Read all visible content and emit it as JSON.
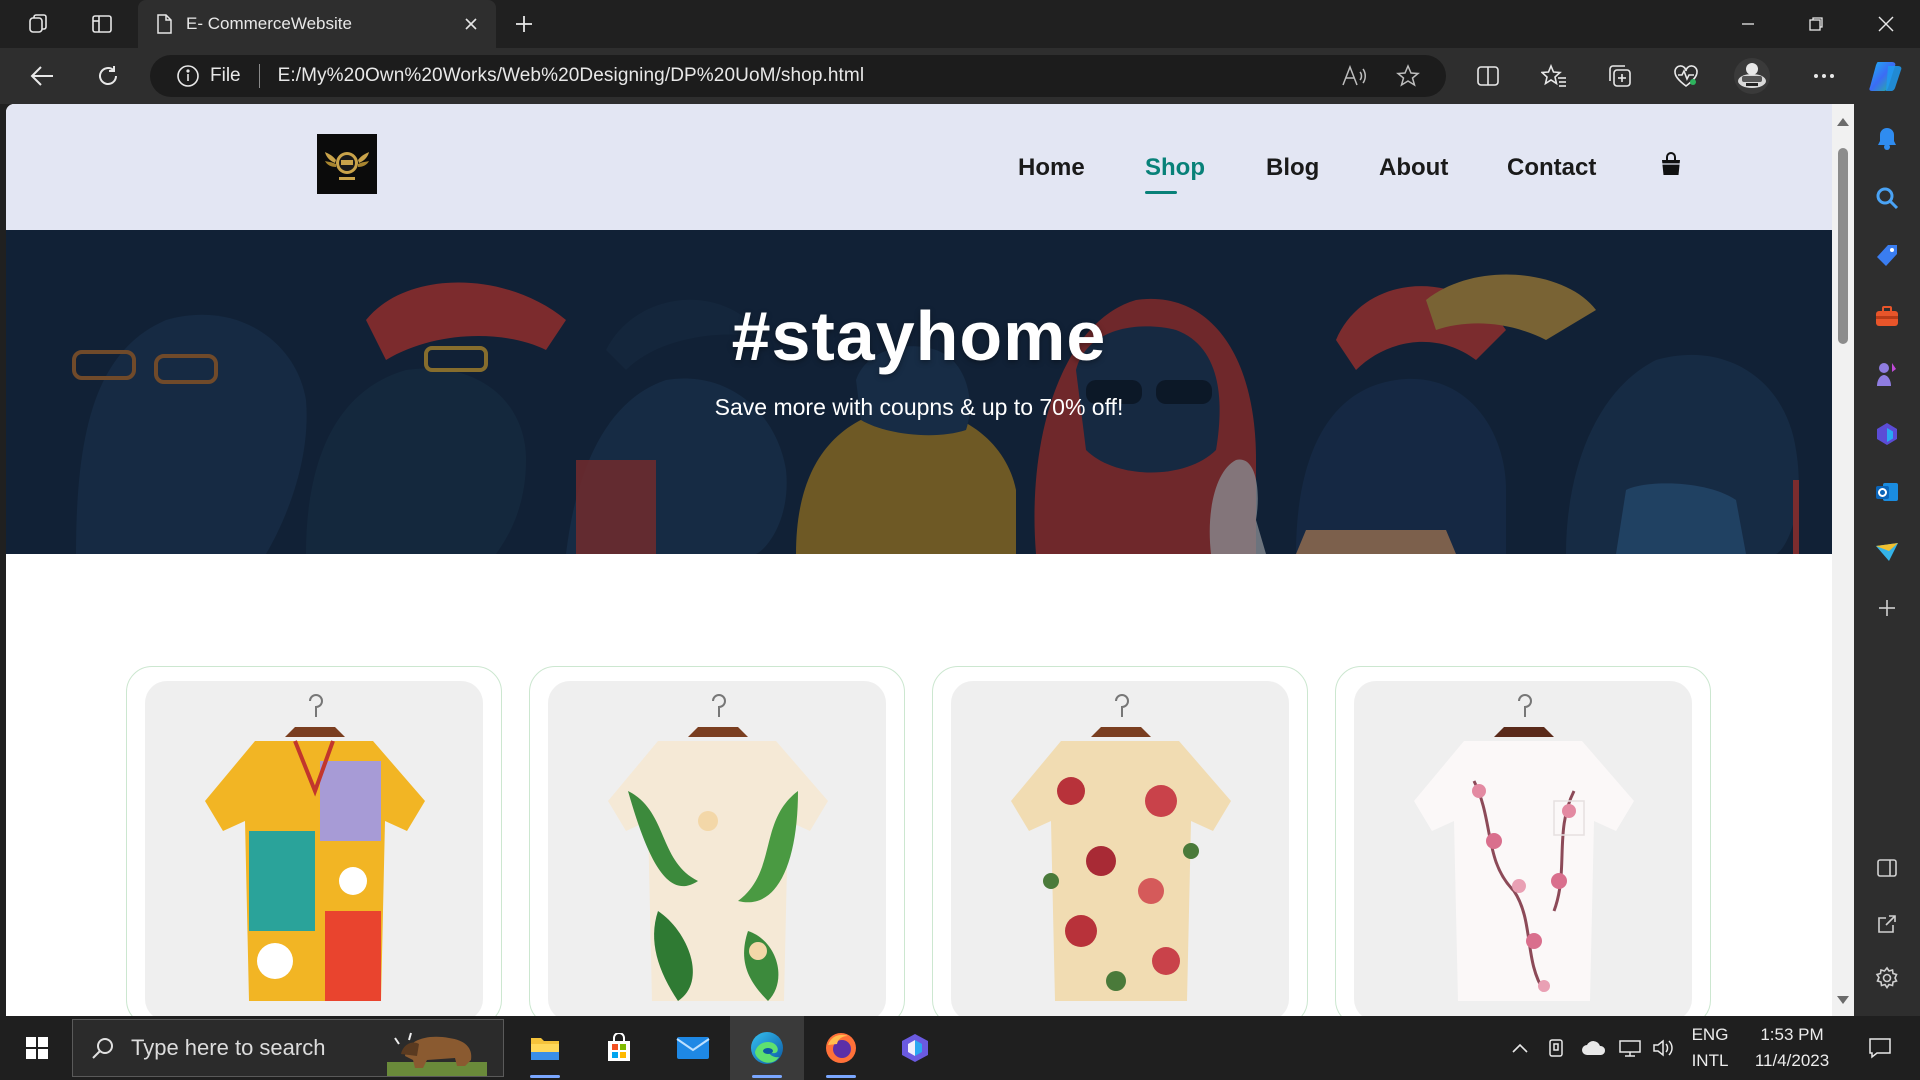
{
  "browser": {
    "tab_title": "E- CommerceWebsite",
    "address": {
      "protocol_label": "File",
      "url": "E:/My%20Own%20Works/Web%20Designing/DP%20UoM/shop.html"
    }
  },
  "site": {
    "nav": [
      {
        "label": "Home",
        "active": false
      },
      {
        "label": "Shop",
        "active": true
      },
      {
        "label": "Blog",
        "active": false
      },
      {
        "label": "About",
        "active": false
      },
      {
        "label": "Contact",
        "active": false
      }
    ],
    "accent_color": "#088178",
    "header_bg": "#e3e6f3",
    "hero": {
      "title": "#stayhome",
      "subtitle": "Save more with coupns & up to 70% off!"
    },
    "products": [
      {
        "image": "colorful-abstract-print-shirt"
      },
      {
        "image": "green-leaf-tropical-print-shirt"
      },
      {
        "image": "red-floral-print-shirt"
      },
      {
        "image": "white-pink-blossom-print-shirt"
      }
    ]
  },
  "taskbar": {
    "search_placeholder": "Type here to search",
    "language_line1": "ENG",
    "language_line2": "INTL",
    "time": "1:53 PM",
    "date": "11/4/2023"
  }
}
